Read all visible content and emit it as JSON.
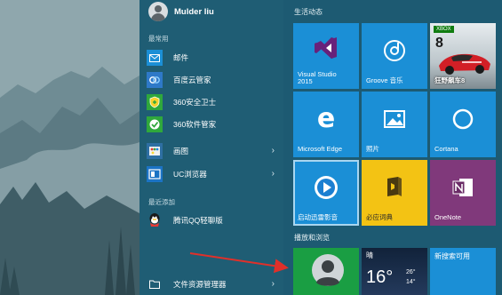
{
  "user": {
    "name": "Mulder liu"
  },
  "left": {
    "most_used_label": "最常用",
    "recently_added_label": "最近添加",
    "items": [
      {
        "label": "邮件",
        "icon": "mail-icon"
      },
      {
        "label": "百度云管家",
        "icon": "baidu-cloud-icon"
      },
      {
        "label": "360安全卫士",
        "icon": "360-security-icon"
      },
      {
        "label": "360软件管家",
        "icon": "360-software-icon"
      },
      {
        "label": "画图",
        "icon": "paint-icon",
        "has_submenu": true
      },
      {
        "label": "UC浏览器",
        "icon": "uc-browser-icon",
        "has_submenu": true
      }
    ],
    "recent_items": [
      {
        "label": "腾讯QQ轻聊版",
        "icon": "qq-icon"
      }
    ],
    "file_explorer": {
      "label": "文件资源管理器",
      "icon": "folder-icon"
    }
  },
  "tiles": {
    "group1_label": "生活动态",
    "group2_label": "播放和浏览",
    "visual_studio": "Visual Studio\n2015",
    "groove": "Groove 音乐",
    "xbox_badge": "XBOX",
    "game_text": "狂野飙车8",
    "edge": "Microsoft Edge",
    "photos": "照片",
    "cortana": "Cortana",
    "xunlei": "启动迅雷影音",
    "dict": "必应词典",
    "onenote": "OneNote",
    "weather_label": "晴",
    "weather_temp": "16°",
    "weather_high": "26°",
    "weather_low": "14°",
    "new_search": "新搜索可用"
  },
  "colors": {
    "menu_bg": "#1f5d74",
    "tile_blue": "#1b8fd6",
    "tile_purple": "#5d2e82",
    "tile_yellow": "#f3c314",
    "tile_green": "#1a9e43",
    "onenote": "#80397b"
  }
}
